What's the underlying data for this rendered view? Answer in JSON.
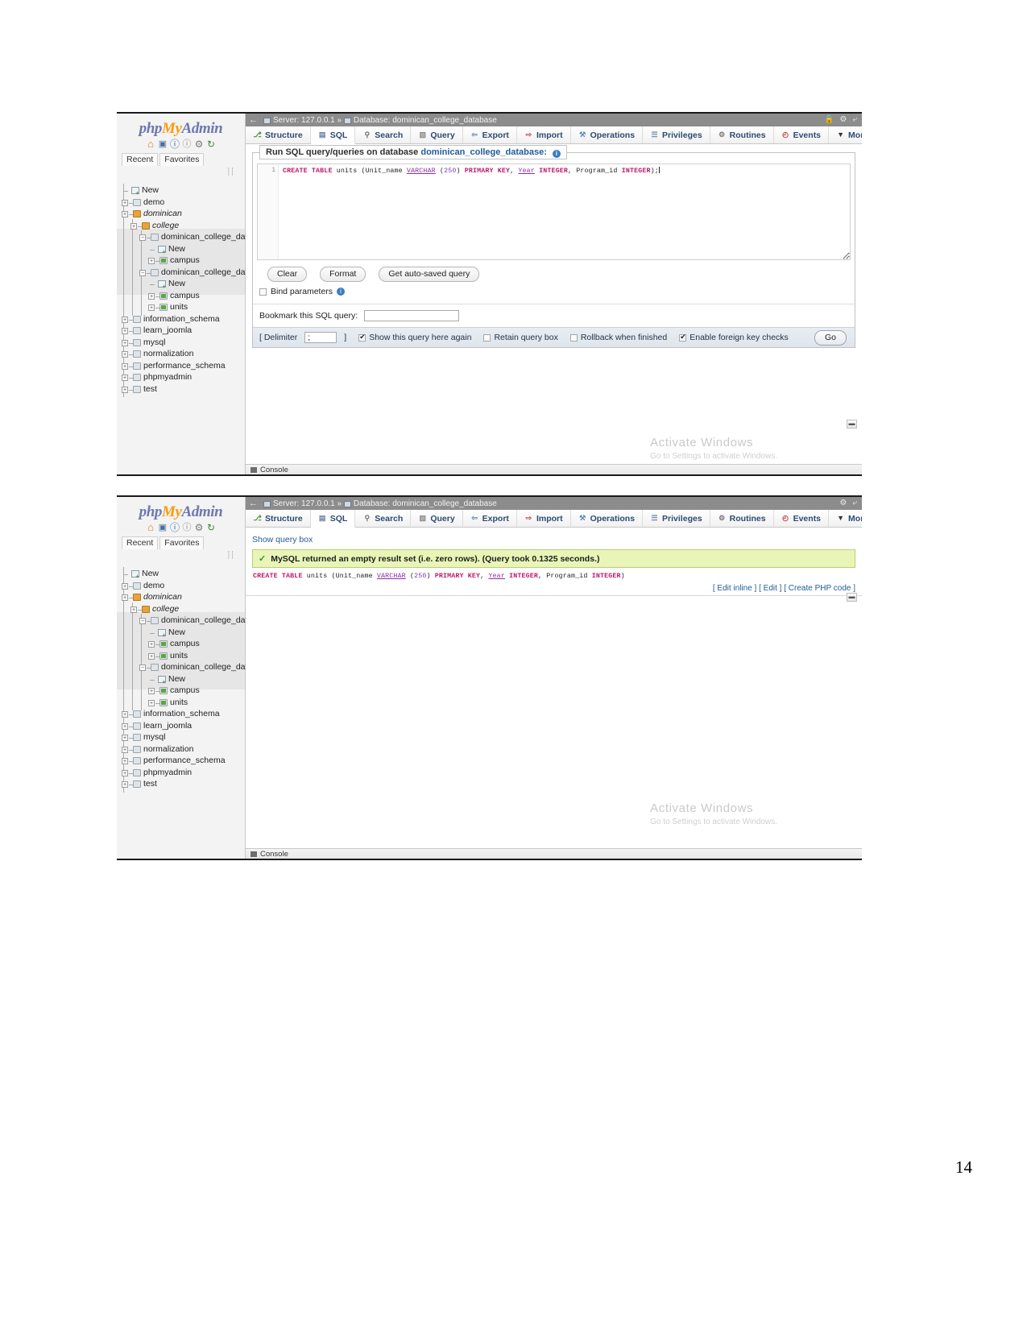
{
  "page": {
    "number": "14"
  },
  "brand": {
    "php": "php",
    "my": "My",
    "admin": "Admin"
  },
  "nav": {
    "icons": [
      "home-icon",
      "exit-icon",
      "help-icon",
      "doc-icon",
      "settings-icon",
      "refresh-icon"
    ],
    "recent": "Recent",
    "favorites": "Favorites",
    "tree": [
      {
        "label": "New",
        "kind": "new",
        "depth": 0
      },
      {
        "label": "demo",
        "kind": "db",
        "depth": 0
      },
      {
        "label": "dominican",
        "kind": "db-open",
        "depth": 0,
        "italic": true
      },
      {
        "label": "college",
        "kind": "db-open",
        "depth": 1,
        "italic": true
      },
      {
        "label": "dominican_college_databa",
        "kind": "db",
        "depth": 2,
        "expanded": true
      },
      {
        "label": "New",
        "kind": "new",
        "depth": 3
      },
      {
        "label": "campus",
        "kind": "table",
        "depth": 3
      },
      {
        "label": "dominican_college_databa",
        "kind": "db",
        "depth": 2,
        "expanded": true
      },
      {
        "label": "New",
        "kind": "new",
        "depth": 3
      },
      {
        "label": "campus",
        "kind": "table",
        "depth": 3
      },
      {
        "label": "units",
        "kind": "table",
        "depth": 3
      },
      {
        "label": "information_schema",
        "kind": "db",
        "depth": 0
      },
      {
        "label": "learn_joomla",
        "kind": "db",
        "depth": 0
      },
      {
        "label": "mysql",
        "kind": "db",
        "depth": 0
      },
      {
        "label": "normalization",
        "kind": "db",
        "depth": 0
      },
      {
        "label": "performance_schema",
        "kind": "db",
        "depth": 0
      },
      {
        "label": "phpmyadmin",
        "kind": "db",
        "depth": 0
      },
      {
        "label": "test",
        "kind": "db",
        "depth": 0
      }
    ]
  },
  "titlebar": {
    "back": "←",
    "server_label": "Server:",
    "server_value": "127.0.0.1",
    "separator": "»",
    "database_label": "Database:",
    "database_value": "dominican_college_database"
  },
  "tabs": [
    {
      "label": "Structure",
      "icon": "structure-icon"
    },
    {
      "label": "SQL",
      "icon": "sql-icon",
      "active": true
    },
    {
      "label": "Search",
      "icon": "search-icon"
    },
    {
      "label": "Query",
      "icon": "query-icon"
    },
    {
      "label": "Export",
      "icon": "export-icon"
    },
    {
      "label": "Import",
      "icon": "import-icon"
    },
    {
      "label": "Operations",
      "icon": "operations-icon"
    },
    {
      "label": "Privileges",
      "icon": "privileges-icon"
    },
    {
      "label": "Routines",
      "icon": "routines-icon"
    },
    {
      "label": "Events",
      "icon": "events-icon"
    },
    {
      "label": "More",
      "icon": "chevron-down-icon"
    }
  ],
  "shot1": {
    "legend_prefix": "Run SQL query/queries on database",
    "legend_db": "dominican_college_database:",
    "line_number": "1",
    "query": {
      "full": "CREATE TABLE units (Unit_name VARCHAR (250) PRIMARY KEY, Year INTEGER, Program_id INTEGER);",
      "tokens": [
        {
          "t": "CREATE",
          "c": "kw"
        },
        {
          "t": " ",
          "c": "nm"
        },
        {
          "t": "TABLE",
          "c": "kw"
        },
        {
          "t": " units (Unit_name ",
          "c": "nm"
        },
        {
          "t": "VARCHAR",
          "c": "ty"
        },
        {
          "t": " (",
          "c": "nm"
        },
        {
          "t": "250",
          "c": "num"
        },
        {
          "t": ") ",
          "c": "nm"
        },
        {
          "t": "PRIMARY KEY",
          "c": "kw"
        },
        {
          "t": ", ",
          "c": "nm"
        },
        {
          "t": "Year",
          "c": "ty"
        },
        {
          "t": " ",
          "c": "nm"
        },
        {
          "t": "INTEGER",
          "c": "kw"
        },
        {
          "t": ", Program_id ",
          "c": "nm"
        },
        {
          "t": "INTEGER",
          "c": "kw"
        },
        {
          "t": ");",
          "c": "nm"
        }
      ]
    },
    "buttons": {
      "clear": "Clear",
      "format": "Format",
      "autosaved": "Get auto-saved query"
    },
    "bind_parameters": "Bind parameters",
    "bookmark_label": "Bookmark this SQL query:",
    "bookmark_value": "",
    "footer": {
      "delimiter_open": "[ Delimiter",
      "delimiter_value": ";",
      "delimiter_close": "]",
      "show_query_again": "Show this query here again",
      "show_query_again_checked": true,
      "retain_query_box": "Retain query box",
      "retain_query_box_checked": false,
      "rollback_when_finished": "Rollback when finished",
      "rollback_when_finished_checked": false,
      "enable_foreign_key_checks": "Enable foreign key checks",
      "enable_foreign_key_checks_checked": true,
      "go": "Go"
    }
  },
  "shot2": {
    "show_query_box": "Show query box",
    "result_message": "MySQL returned an empty result set (i.e. zero rows). (Query took 0.1325 seconds.)",
    "echo_tokens": [
      {
        "t": "CREATE",
        "c": "kw"
      },
      {
        "t": " ",
        "c": "nm"
      },
      {
        "t": "TABLE",
        "c": "kw"
      },
      {
        "t": " units (Unit_name ",
        "c": "nm"
      },
      {
        "t": "VARCHAR",
        "c": "ty"
      },
      {
        "t": " (",
        "c": "nm"
      },
      {
        "t": "250",
        "c": "num"
      },
      {
        "t": ") ",
        "c": "nm"
      },
      {
        "t": "PRIMARY KEY",
        "c": "kw"
      },
      {
        "t": ", ",
        "c": "nm"
      },
      {
        "t": "Year",
        "c": "ty"
      },
      {
        "t": " ",
        "c": "nm"
      },
      {
        "t": "INTEGER",
        "c": "kw"
      },
      {
        "t": ", Program_id ",
        "c": "nm"
      },
      {
        "t": "INTEGER",
        "c": "kw"
      },
      {
        "t": ")",
        "c": "nm"
      }
    ],
    "links": {
      "edit_inline": "[ Edit inline ]",
      "edit": "[ Edit ]",
      "create_php": "[ Create PHP code ]"
    },
    "tree_extra_units": "units"
  },
  "watermark": {
    "line1": "Activate Windows",
    "line2": "Go to Settings to activate Windows."
  },
  "console": {
    "label": "Console"
  },
  "colors": {
    "accent_blue": "#235b9b",
    "titlebar_gray": "#8c8c8c",
    "result_green_bg": "#e9f5b8",
    "result_green_border": "#b9cf6f",
    "brand_orange": "#f89c0e",
    "brand_blue": "#6c78af"
  }
}
